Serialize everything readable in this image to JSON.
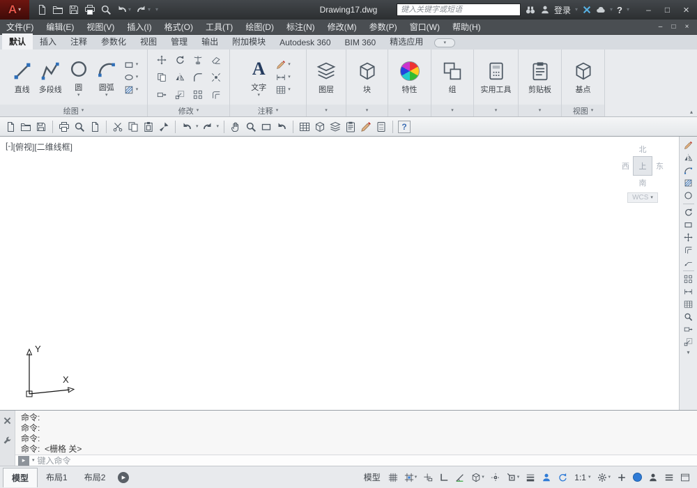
{
  "ui": {
    "caret": "▾",
    "caret_up": "▴",
    "prompt": "▸",
    "minimize": "–",
    "maximize": "□",
    "close": "×"
  },
  "titlebar": {
    "logo_letter": "A",
    "title": "Drawing17.dwg",
    "search_placeholder": "键入关键字或短语",
    "login_label": "登录",
    "help_label": "?"
  },
  "menubar": {
    "items": [
      "文件(F)",
      "编辑(E)",
      "视图(V)",
      "插入(I)",
      "格式(O)",
      "工具(T)",
      "绘图(D)",
      "标注(N)",
      "修改(M)",
      "参数(P)",
      "窗口(W)",
      "帮助(H)"
    ]
  },
  "ribbon": {
    "tabs": [
      "默认",
      "插入",
      "注释",
      "参数化",
      "视图",
      "管理",
      "输出",
      "附加模块",
      "Autodesk 360",
      "BIM 360",
      "精选应用"
    ],
    "buttons": {
      "line": "直线",
      "polyline": "多段线",
      "circle": "圆",
      "arc": "圆弧",
      "text": "文字",
      "layers": "图层",
      "block": "块",
      "properties": "特性",
      "group": "组",
      "utilities": "实用工具",
      "clipboard": "剪贴板",
      "base": "基点"
    },
    "panels": {
      "draw": "绘图",
      "modify": "修改",
      "annotate": "注释",
      "view": "视图"
    }
  },
  "viewport": {
    "controls_label": "[-]",
    "view_label": "[俯视]",
    "style_label": "[二维线框]",
    "viewcube": {
      "north": "北",
      "south": "南",
      "west": "西",
      "east": "东",
      "top": "上",
      "wcs": "WCS"
    },
    "ucs": {
      "x_label": "X",
      "y_label": "Y"
    }
  },
  "command": {
    "lines": [
      "命令:",
      "命令:",
      "命令:",
      "命令:  <栅格 关>"
    ],
    "input_placeholder": "键入命令"
  },
  "statusbar": {
    "tabs": [
      "模型",
      "布局1",
      "布局2"
    ],
    "model_label": "模型",
    "scale_label": "1:1"
  }
}
